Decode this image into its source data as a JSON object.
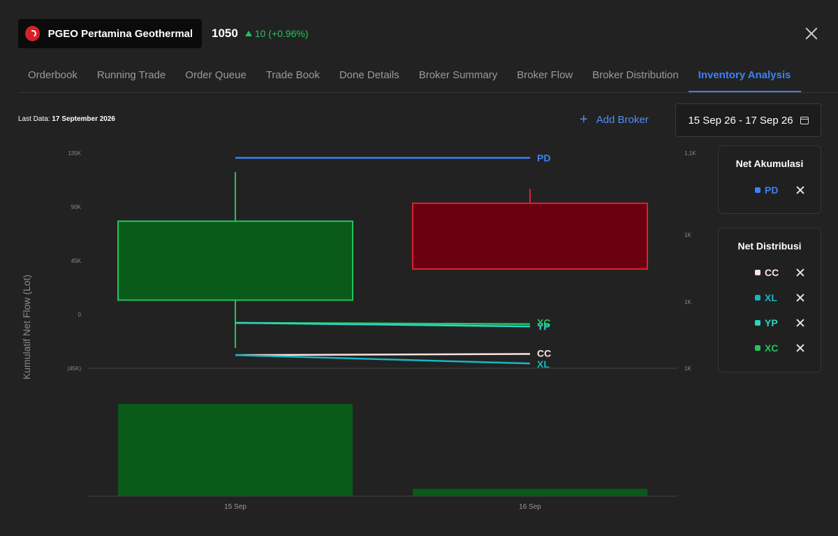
{
  "header": {
    "ticker_name": "PGEO Pertamina Geothermal...",
    "price": "1050",
    "change": "10 (+0.96%)"
  },
  "tabs": [
    {
      "label": "Orderbook"
    },
    {
      "label": "Running Trade"
    },
    {
      "label": "Order Queue"
    },
    {
      "label": "Trade Book"
    },
    {
      "label": "Done Details"
    },
    {
      "label": "Broker Summary"
    },
    {
      "label": "Broker Flow"
    },
    {
      "label": "Broker Distribution"
    },
    {
      "label": "Inventory Analysis",
      "active": true
    }
  ],
  "last_data_label": "Last Data:",
  "last_data_value": "17 September 2026",
  "add_broker": "Add Broker",
  "date_range": "15 Sep 26 - 17 Sep 26",
  "legend": {
    "accumulation_title": "Net Akumulasi",
    "accumulation": [
      {
        "name": "PD",
        "color": "#3b82f6"
      }
    ],
    "distribution_title": "Net Distribusi",
    "distribution": [
      {
        "name": "CC",
        "color": "#fde2e2"
      },
      {
        "name": "XL",
        "color": "#14b8c4"
      },
      {
        "name": "YP",
        "color": "#2dd4bf"
      },
      {
        "name": "XC",
        "color": "#22c55e"
      }
    ]
  },
  "colors": {
    "up": "#22c55e",
    "down": "#e0202f",
    "up_fill": "#0a5a1a",
    "down_fill": "#6b0010",
    "accent": "#3b82f6"
  },
  "chart_data": {
    "type": "candlestick",
    "ylabel": "Kumulatif Net Flow (Lot)",
    "y_ticks": [
      "135K",
      "90K",
      "45K",
      "0",
      "(45K)"
    ],
    "y_min": -45000,
    "y_max": 135000,
    "y2_ticks": [
      "1,1K",
      "1K",
      "1K",
      "1K"
    ],
    "categories": [
      "15 Sep",
      "16 Sep"
    ],
    "candles": [
      {
        "date": "15 Sep",
        "open": 12000,
        "close": 78000,
        "high": 119000,
        "low": -28000,
        "direction": "up"
      },
      {
        "date": "16 Sep",
        "open": 93000,
        "close": 38000,
        "high": 105000,
        "low": 38000,
        "direction": "down"
      }
    ],
    "volume": [
      {
        "date": "15 Sep",
        "value": 100,
        "direction": "up"
      },
      {
        "date": "16 Sep",
        "value": 8,
        "direction": "up"
      }
    ],
    "series": [
      {
        "name": "PD",
        "color": "#3b82f6",
        "values": [
          131000,
          131000
        ]
      },
      {
        "name": "XC",
        "color": "#22c55e",
        "values": [
          -7000,
          -8000
        ]
      },
      {
        "name": "YP",
        "color": "#2dd4bf",
        "values": [
          -7000,
          -10000
        ]
      },
      {
        "name": "CC",
        "color": "#fde2e2",
        "values": [
          -34000,
          -33000
        ]
      },
      {
        "name": "XL",
        "color": "#14b8c4",
        "values": [
          -34000,
          -41000
        ]
      }
    ]
  }
}
